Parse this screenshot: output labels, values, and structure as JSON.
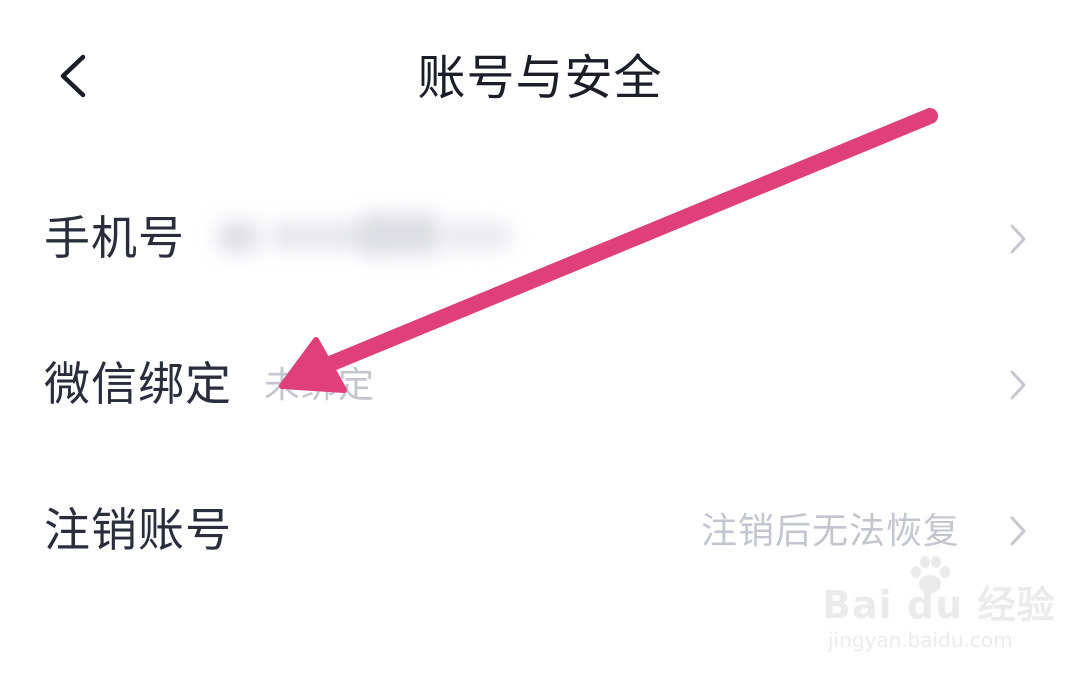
{
  "header": {
    "title": "账号与安全",
    "back_icon": "chevron-left-icon"
  },
  "rows": [
    {
      "label": "手机号",
      "value": "",
      "value_note": "blurred / redacted"
    },
    {
      "label": "微信绑定",
      "value": "未绑定"
    },
    {
      "label": "注销账号",
      "value": "注销后无法恢复"
    }
  ],
  "icons": {
    "row_chevron": "chevron-right-icon"
  },
  "annotation": {
    "type": "arrow",
    "color": "#e0407a"
  },
  "watermark": {
    "brand": "Bai du 经验",
    "url": "jingyan.baidu.com"
  },
  "colors": {
    "background": "#ffffff",
    "title_text": "#1b1d28",
    "label_text": "#2a2d3c",
    "secondary_text": "#c3c6ce",
    "chevron": "#c6c8ce",
    "arrow": "#e0407a"
  }
}
